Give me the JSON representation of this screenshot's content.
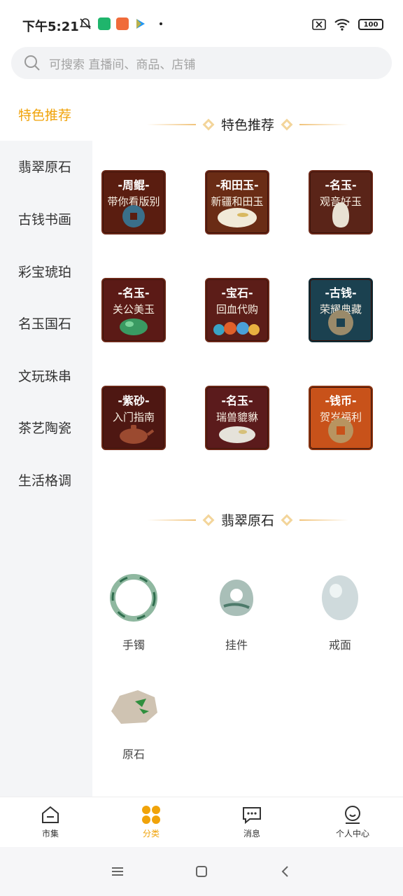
{
  "status_bar": {
    "time": "下午5:21",
    "battery": "100"
  },
  "search": {
    "placeholder": "可搜索 直播间、商品、店铺"
  },
  "sidebar": {
    "items": [
      {
        "label": "特色推荐",
        "active": true
      },
      {
        "label": "翡翠原石"
      },
      {
        "label": "古钱书画"
      },
      {
        "label": "彩宝琥珀"
      },
      {
        "label": "名玉国石"
      },
      {
        "label": "文玩珠串"
      },
      {
        "label": "茶艺陶瓷"
      },
      {
        "label": "生活格调"
      }
    ]
  },
  "sections": [
    {
      "title": "特色推荐",
      "cards": [
        {
          "head": "-周鲲-",
          "sub": "带你看版别",
          "color": "#5a1d10"
        },
        {
          "head": "-和田玉-",
          "sub": "新疆和田玉",
          "color": "#6a2c15"
        },
        {
          "head": "-名玉-",
          "sub": "观音好玉",
          "color": "#5a2418"
        },
        {
          "head": "-名玉-",
          "sub": "关公美玉",
          "color": "#5b1a16"
        },
        {
          "head": "-宝石-",
          "sub": "回血代购",
          "color": "#5c1d18"
        },
        {
          "head": "-古钱-",
          "sub": "荣耀典藏",
          "color": "#1b4150"
        },
        {
          "head": "-紫砂-",
          "sub": "入门指南",
          "color": "#4e1712"
        },
        {
          "head": "-名玉-",
          "sub": "瑞兽貔貅",
          "color": "#5b1b1c"
        },
        {
          "head": "-钱币-",
          "sub": "贺岁福利",
          "color": "#c8521a"
        }
      ]
    },
    {
      "title": "翡翠原石",
      "products": [
        {
          "label": "手镯"
        },
        {
          "label": "挂件"
        },
        {
          "label": "戒面"
        },
        {
          "label": "原石"
        }
      ]
    }
  ],
  "bottom_nav": [
    {
      "label": "市集",
      "icon": "market-icon"
    },
    {
      "label": "分类",
      "icon": "category-icon",
      "active": true
    },
    {
      "label": "消息",
      "icon": "message-icon"
    },
    {
      "label": "个人中心",
      "icon": "profile-icon"
    }
  ],
  "colors": {
    "accent": "#f0a30a",
    "sidebar_bg": "#f4f5f7"
  }
}
